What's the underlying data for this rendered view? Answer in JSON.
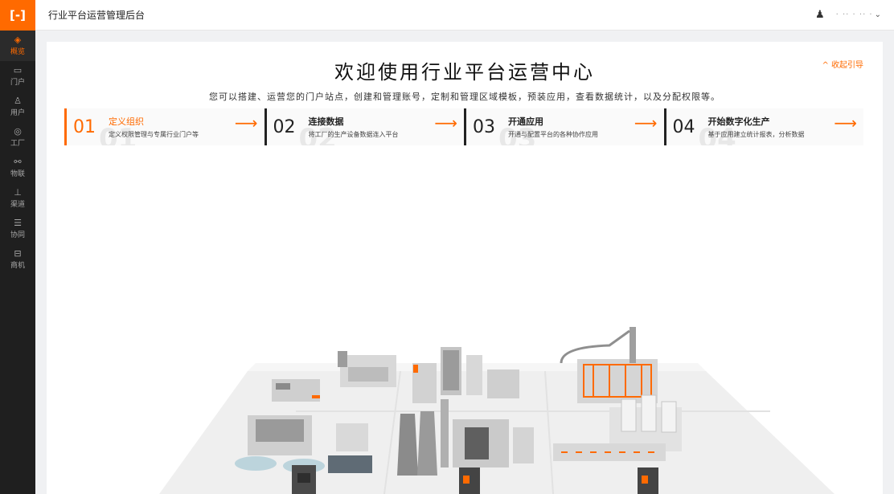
{
  "app": {
    "logo_text": "[-]",
    "title": "行业平台运营管理后台",
    "brand_color": "#ff6a00"
  },
  "header": {
    "user_name": "· ·· · ·· ·",
    "bell_icon": "bell-icon",
    "chevron_icon": "chevron-down-icon"
  },
  "sidebar": {
    "items": [
      {
        "label": "概览",
        "icon": "layers-icon",
        "glyph": "◈",
        "active": true
      },
      {
        "label": "门户",
        "icon": "monitor-icon",
        "glyph": "▭",
        "active": false
      },
      {
        "label": "用户",
        "icon": "user-icon",
        "glyph": "♙",
        "active": false
      },
      {
        "label": "工厂",
        "icon": "compass-icon",
        "glyph": "◎",
        "active": false
      },
      {
        "label": "物联",
        "icon": "link-icon",
        "glyph": "⚯",
        "active": false
      },
      {
        "label": "渠道",
        "icon": "hierarchy-icon",
        "glyph": "⊥",
        "active": false
      },
      {
        "label": "协同",
        "icon": "stack-icon",
        "glyph": "☰",
        "active": false
      },
      {
        "label": "商机",
        "icon": "briefcase-icon",
        "glyph": "⊟",
        "active": false
      }
    ]
  },
  "main": {
    "welcome_title": "欢迎使用行业平台运营中心",
    "collapse_label": "^ 收起引导",
    "subtitle": "您可以搭建、运营您的门户站点，创建和管理账号，定制和管理区域模板，预装应用，查看数据统计，以及分配权限等。",
    "steps": [
      {
        "num": "01",
        "title": "定义组织",
        "desc": "定义权限管理与专属行业门户等",
        "active": true
      },
      {
        "num": "02",
        "title": "连接数据",
        "desc": "将工厂的生产设备数据连入平台",
        "active": false
      },
      {
        "num": "03",
        "title": "开通应用",
        "desc": "开通与配置平台的各种协作应用",
        "active": false
      },
      {
        "num": "04",
        "title": "开始数字化生产",
        "desc": "基于应用建立统计报表，分析数据",
        "active": false
      }
    ],
    "arrow_glyph": "⟶"
  }
}
